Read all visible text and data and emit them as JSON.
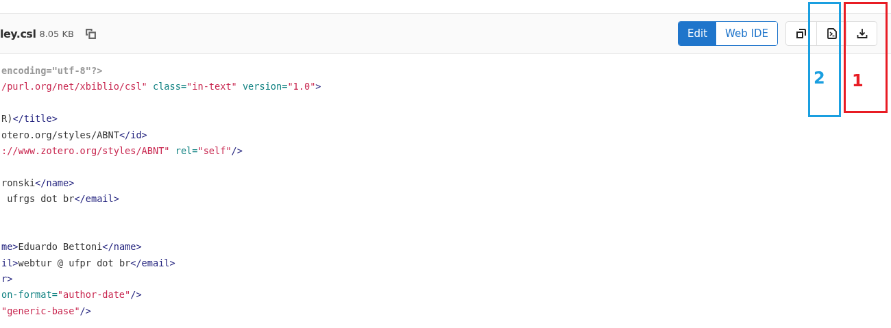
{
  "file": {
    "name": "ley.csl",
    "size": "8.05 KB"
  },
  "actions": [
    {
      "label": "Edit",
      "selected": true
    },
    {
      "label": "Web IDE",
      "selected": false
    }
  ],
  "tool_buttons": [
    {
      "kind": "copy"
    },
    {
      "kind": "raw"
    },
    {
      "kind": "download"
    }
  ],
  "annotations": [
    {
      "label": "2",
      "color": "#1a9fe0",
      "kind": "blue"
    },
    {
      "label": "1",
      "color": "#e81c24",
      "kind": "red"
    }
  ],
  "lines": [
    {
      "kind": "code",
      "tokens": [
        {
          "kind": "prolog",
          "text": "encoding=\"utf-8\"?>"
        }
      ]
    },
    {
      "kind": "code",
      "tokens": [
        {
          "kind": "string",
          "text": "/purl.org/net/xbiblio/csl\" "
        },
        {
          "kind": "attr",
          "text": "class="
        },
        {
          "kind": "string",
          "text": "\"in-text\" "
        },
        {
          "kind": "attr",
          "text": "version="
        },
        {
          "kind": "string",
          "text": "\"1.0\""
        },
        {
          "kind": "tag",
          "text": ">"
        }
      ]
    },
    {
      "kind": "blank"
    },
    {
      "kind": "code",
      "tokens": [
        {
          "kind": "text",
          "text": "R)"
        },
        {
          "kind": "tag",
          "text": "</title>"
        }
      ]
    },
    {
      "kind": "code",
      "tokens": [
        {
          "kind": "text",
          "text": "otero.org/styles/ABNT"
        },
        {
          "kind": "tag",
          "text": "</id>"
        }
      ]
    },
    {
      "kind": "code",
      "tokens": [
        {
          "kind": "string",
          "text": "://www.zotero.org/styles/ABNT\" "
        },
        {
          "kind": "attr",
          "text": "rel="
        },
        {
          "kind": "string",
          "text": "\"self\""
        },
        {
          "kind": "tag",
          "text": "/>"
        }
      ]
    },
    {
      "kind": "blank"
    },
    {
      "kind": "code",
      "tokens": [
        {
          "kind": "text",
          "text": "ronski"
        },
        {
          "kind": "tag",
          "text": "</name>"
        }
      ]
    },
    {
      "kind": "code",
      "tokens": [
        {
          "kind": "text",
          "text": " ufrgs dot br"
        },
        {
          "kind": "tag",
          "text": "</email>"
        }
      ]
    },
    {
      "kind": "blank"
    },
    {
      "kind": "blank"
    },
    {
      "kind": "code",
      "tokens": [
        {
          "kind": "tag",
          "text": "me>"
        },
        {
          "kind": "text",
          "text": "Eduardo Bettoni"
        },
        {
          "kind": "tag",
          "text": "</name>"
        }
      ]
    },
    {
      "kind": "code",
      "tokens": [
        {
          "kind": "tag",
          "text": "il>"
        },
        {
          "kind": "text",
          "text": "webtur @ ufpr dot br"
        },
        {
          "kind": "tag",
          "text": "</email>"
        }
      ]
    },
    {
      "kind": "code",
      "tokens": [
        {
          "kind": "tag",
          "text": "r>"
        }
      ]
    },
    {
      "kind": "code",
      "tokens": [
        {
          "kind": "attr",
          "text": "on-format="
        },
        {
          "kind": "string",
          "text": "\"author-date\""
        },
        {
          "kind": "tag",
          "text": "/>"
        }
      ]
    },
    {
      "kind": "code",
      "tokens": [
        {
          "kind": "string",
          "text": "\"generic-base\""
        },
        {
          "kind": "tag",
          "text": "/>"
        }
      ]
    }
  ]
}
